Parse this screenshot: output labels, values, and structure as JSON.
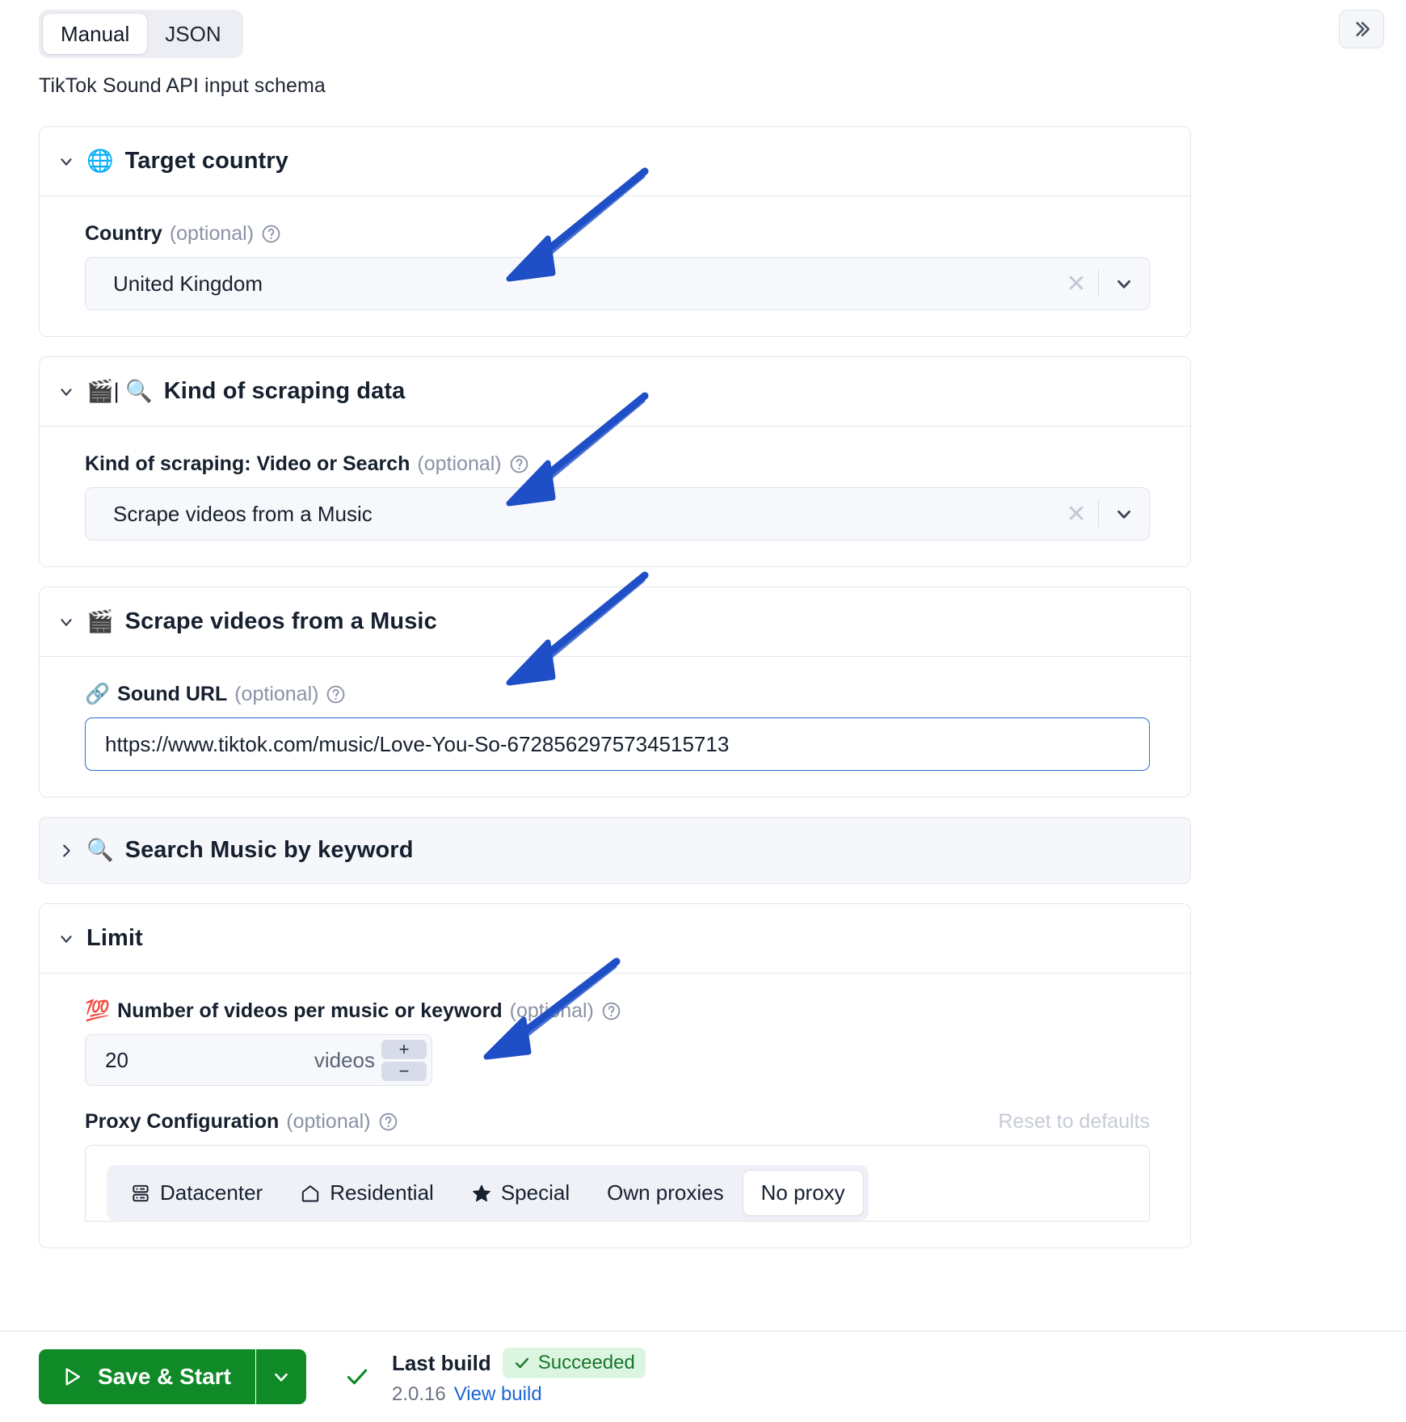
{
  "topbar": {
    "tabs": [
      {
        "label": "Manual",
        "active": true
      },
      {
        "label": "JSON",
        "active": false
      }
    ],
    "collapse_icon": "chevron-double-right-icon"
  },
  "schema_caption": "TikTok Sound API input schema",
  "sections": [
    {
      "id": "target-country",
      "emoji": "🌐",
      "icon_name": "globe-icon",
      "title": "Target country",
      "expanded": true,
      "field": {
        "label": "Country",
        "optional": "(optional)",
        "control": "select",
        "value": "United Kingdom",
        "clear_icon": "close-icon",
        "caret_icon": "chevron-down-icon"
      }
    },
    {
      "id": "kind-of-scraping-data",
      "emoji": "🎬| 🔍",
      "icon_name": "clapper-board-and-magnifier-icon",
      "title": "Kind of scraping data",
      "expanded": true,
      "field": {
        "label": "Kind of scraping: Video or Search",
        "optional": "(optional)",
        "control": "select",
        "value": "Scrape videos from a Music",
        "clear_icon": "close-icon",
        "caret_icon": "chevron-down-icon"
      }
    },
    {
      "id": "scrape-videos-from-a-music",
      "emoji": "🎬",
      "icon_name": "clapper-board-icon",
      "title": "Scrape videos from a Music",
      "expanded": true,
      "field": {
        "label": "Sound URL",
        "label_emoji": "🔗",
        "optional": "(optional)",
        "control": "text",
        "value": "https://www.tiktok.com/music/Love-You-So-6728562975734515713"
      }
    },
    {
      "id": "search-music-by-keyword",
      "emoji": "🔍",
      "icon_name": "magnifier-icon",
      "title": "Search Music by keyword",
      "expanded": false
    },
    {
      "id": "limit",
      "emoji": "",
      "icon_name": "",
      "title": "Limit",
      "expanded": true,
      "field": {
        "label": "Number of videos per music or keyword",
        "label_emoji": "💯",
        "optional": "(optional)",
        "control": "number",
        "value": "20",
        "unit": "videos",
        "increment_label": "+",
        "decrement_label": "−"
      },
      "proxy": {
        "label": "Proxy Configuration",
        "optional": "(optional)",
        "reset_label": "Reset to defaults",
        "tabs": [
          {
            "label": "Datacenter",
            "icon": "server-icon",
            "selected": false
          },
          {
            "label": "Residential",
            "icon": "home-icon",
            "selected": false
          },
          {
            "label": "Special",
            "icon": "star-icon",
            "selected": false
          },
          {
            "label": "Own proxies",
            "icon": "",
            "selected": false
          },
          {
            "label": "No proxy",
            "icon": "",
            "selected": true
          }
        ]
      }
    }
  ],
  "bottombar": {
    "save_start_label": "Save & Start",
    "play_icon": "play-icon",
    "dropdown_icon": "chevron-down-icon",
    "status_check_icon": "check-icon",
    "last_build_label": "Last build",
    "status_badge": "Succeeded",
    "status_badge_icon": "check-icon",
    "version": "2.0.16",
    "view_build_label": "View build"
  },
  "colors": {
    "accent_green": "#0f8a27",
    "link_blue": "#1a66d6",
    "focus_blue": "#2d6fd1",
    "annotation_blue": "#1f54c9",
    "badge_bg": "#dcf5e0"
  }
}
